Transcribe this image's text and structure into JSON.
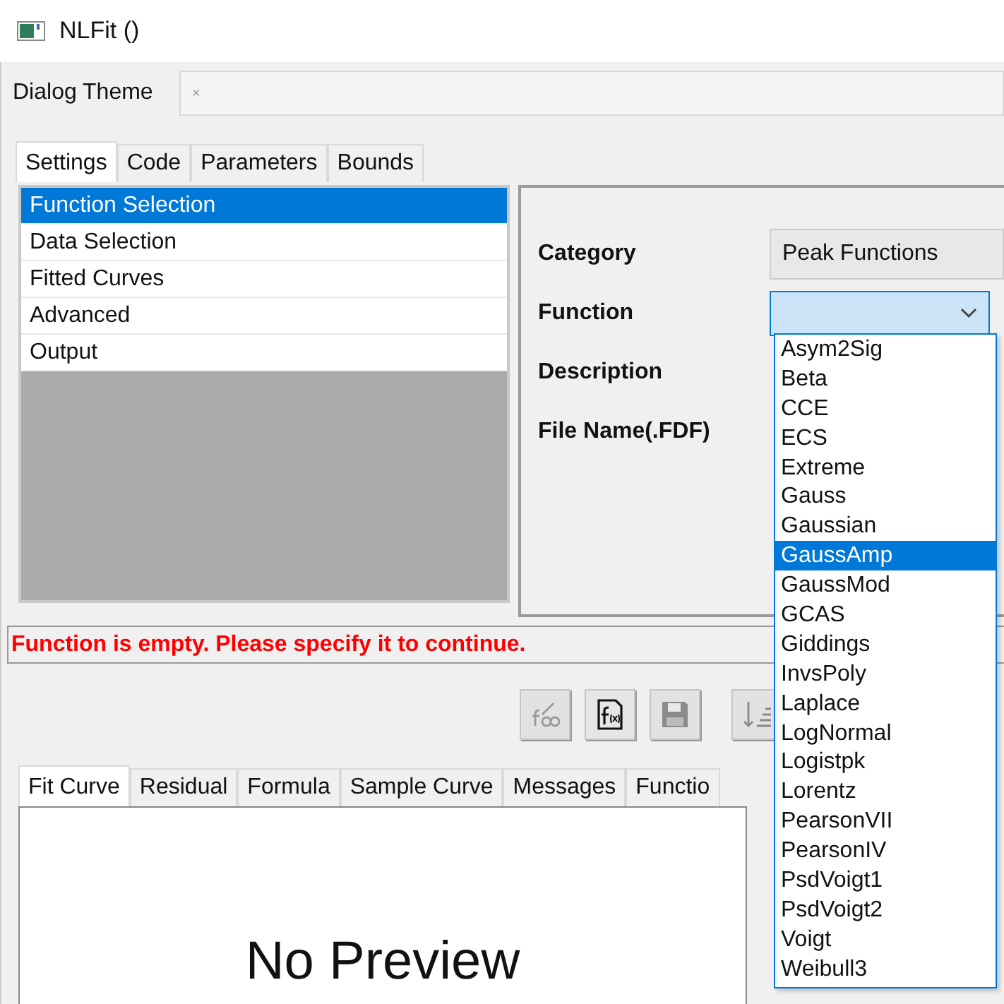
{
  "window": {
    "title": "NLFit ()"
  },
  "dialog_theme": {
    "label": "Dialog Theme",
    "value": "×"
  },
  "tabs": [
    {
      "label": "Settings",
      "selected": true
    },
    {
      "label": "Code",
      "selected": false
    },
    {
      "label": "Parameters",
      "selected": false
    },
    {
      "label": "Bounds",
      "selected": false
    }
  ],
  "settings_list": [
    {
      "label": "Function Selection",
      "selected": true
    },
    {
      "label": "Data Selection",
      "selected": false
    },
    {
      "label": "Fitted Curves",
      "selected": false
    },
    {
      "label": "Advanced",
      "selected": false
    },
    {
      "label": "Output",
      "selected": false
    }
  ],
  "function_panel": [
    {
      "label": "Category",
      "kind": "readonly",
      "value": "Peak Functions"
    },
    {
      "label": "Function",
      "kind": "combo"
    },
    {
      "label": "Description",
      "kind": "text"
    },
    {
      "label": "File Name(.FDF)",
      "kind": "text"
    }
  ],
  "function_dropdown": [
    {
      "label": "Asym2Sig",
      "selected": false
    },
    {
      "label": "Beta",
      "selected": false
    },
    {
      "label": "CCE",
      "selected": false
    },
    {
      "label": "ECS",
      "selected": false
    },
    {
      "label": "Extreme",
      "selected": false
    },
    {
      "label": "Gauss",
      "selected": false
    },
    {
      "label": "Gaussian",
      "selected": false
    },
    {
      "label": "GaussAmp",
      "selected": true
    },
    {
      "label": "GaussMod",
      "selected": false
    },
    {
      "label": "GCAS",
      "selected": false
    },
    {
      "label": "Giddings",
      "selected": false
    },
    {
      "label": "InvsPoly",
      "selected": false
    },
    {
      "label": "Laplace",
      "selected": false
    },
    {
      "label": "LogNormal",
      "selected": false
    },
    {
      "label": "Logistpk",
      "selected": false
    },
    {
      "label": "Lorentz",
      "selected": false
    },
    {
      "label": "PearsonVII",
      "selected": false
    },
    {
      "label": "PearsonIV",
      "selected": false
    },
    {
      "label": "PsdVoigt1",
      "selected": false
    },
    {
      "label": "PsdVoigt2",
      "selected": false
    },
    {
      "label": "Voigt",
      "selected": false
    },
    {
      "label": "Weibull3",
      "selected": false
    }
  ],
  "error_message": "Function is empty. Please specify it to continue.",
  "toolbar": [
    {
      "kind": "edit",
      "disabled": true
    },
    {
      "kind": "formula",
      "disabled": false
    },
    {
      "kind": "save",
      "disabled": true
    },
    {
      "kind": "sort",
      "disabled": true
    }
  ],
  "preview_tabs": [
    {
      "label": "Fit Curve",
      "selected": true
    },
    {
      "label": "Residual",
      "selected": false
    },
    {
      "label": "Formula",
      "selected": false
    },
    {
      "label": "Sample Curve",
      "selected": false
    },
    {
      "label": "Messages",
      "selected": false
    },
    {
      "label": "Functio",
      "selected": false
    }
  ],
  "preview": {
    "message": "No Preview"
  }
}
